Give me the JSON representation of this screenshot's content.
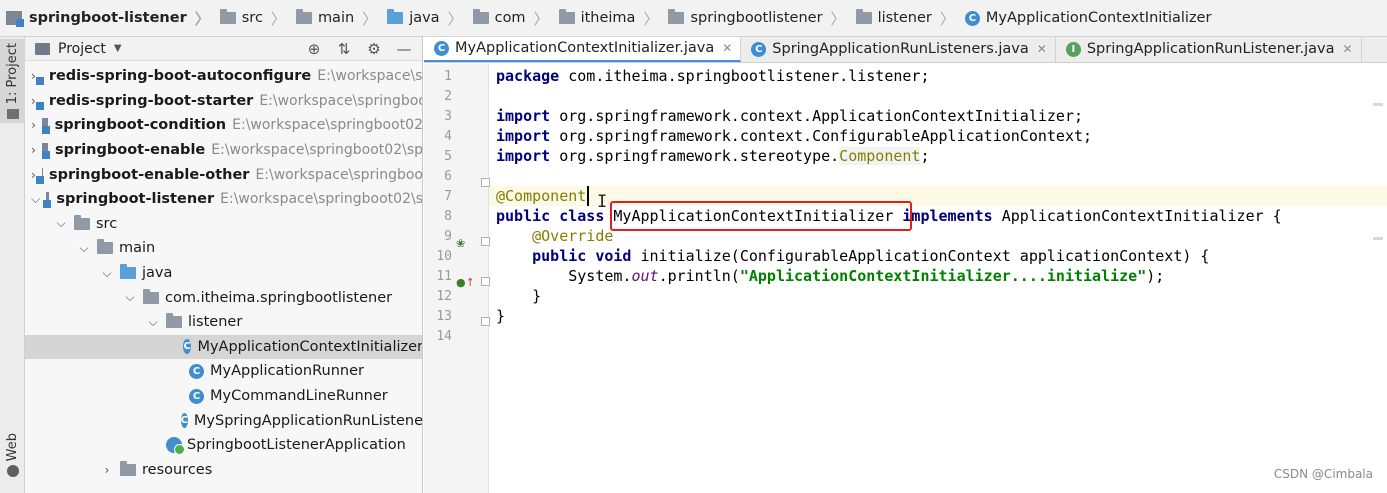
{
  "breadcrumb": [
    {
      "label": "springboot-listener",
      "icon": "module-icon"
    },
    {
      "label": "src",
      "icon": "folder-icon"
    },
    {
      "label": "main",
      "icon": "folder-icon"
    },
    {
      "label": "java",
      "icon": "source-folder-icon"
    },
    {
      "label": "com",
      "icon": "folder-icon"
    },
    {
      "label": "itheima",
      "icon": "folder-icon"
    },
    {
      "label": "springbootlistener",
      "icon": "folder-icon"
    },
    {
      "label": "listener",
      "icon": "folder-icon"
    },
    {
      "label": "MyApplicationContextInitializer",
      "icon": "class-icon"
    }
  ],
  "tool_strip": {
    "project_tab": "1: Project",
    "web_tab": "Web"
  },
  "panel": {
    "title": "Project",
    "tree": [
      {
        "label": "redis-spring-boot-autoconfigure",
        "path": "E:\\workspace\\sp",
        "bold": true,
        "arrow": "›",
        "icon": "module-icon",
        "indent": 0
      },
      {
        "label": "redis-spring-boot-starter",
        "path": "E:\\workspace\\springboo",
        "bold": true,
        "arrow": "›",
        "icon": "module-icon",
        "indent": 0
      },
      {
        "label": "springboot-condition",
        "path": "E:\\workspace\\springboot02",
        "bold": true,
        "arrow": "›",
        "icon": "module-icon",
        "indent": 0
      },
      {
        "label": "springboot-enable",
        "path": "E:\\workspace\\springboot02\\sp",
        "bold": true,
        "arrow": "›",
        "icon": "module-icon",
        "indent": 0
      },
      {
        "label": "springboot-enable-other",
        "path": "E:\\workspace\\springboo",
        "bold": true,
        "arrow": "›",
        "icon": "module-icon",
        "indent": 0
      },
      {
        "label": "springboot-listener",
        "path": "E:\\workspace\\springboot02\\s",
        "bold": true,
        "arrow": "⌄",
        "icon": "module-icon",
        "indent": 0
      },
      {
        "label": "src",
        "path": "",
        "bold": false,
        "arrow": "⌄",
        "icon": "folder-icon",
        "indent": 1
      },
      {
        "label": "main",
        "path": "",
        "bold": false,
        "arrow": "⌄",
        "icon": "folder-icon",
        "indent": 2
      },
      {
        "label": "java",
        "path": "",
        "bold": false,
        "arrow": "⌄",
        "icon": "source-folder-icon",
        "indent": 3
      },
      {
        "label": "com.itheima.springbootlistener",
        "path": "",
        "bold": false,
        "arrow": "⌄",
        "icon": "package-icon",
        "indent": 4
      },
      {
        "label": "listener",
        "path": "",
        "bold": false,
        "arrow": "⌄",
        "icon": "package-icon",
        "indent": 5
      },
      {
        "label": "MyApplicationContextInitializer",
        "path": "",
        "bold": false,
        "arrow": "",
        "icon": "class-icon",
        "indent": 6,
        "selected": true
      },
      {
        "label": "MyApplicationRunner",
        "path": "",
        "bold": false,
        "arrow": "",
        "icon": "class-icon",
        "indent": 6
      },
      {
        "label": "MyCommandLineRunner",
        "path": "",
        "bold": false,
        "arrow": "",
        "icon": "class-icon",
        "indent": 6
      },
      {
        "label": "MySpringApplicationRunListene",
        "path": "",
        "bold": false,
        "arrow": "",
        "icon": "class-icon",
        "indent": 6
      },
      {
        "label": "SpringbootListenerApplication",
        "path": "",
        "bold": false,
        "arrow": "",
        "icon": "spring-app-icon",
        "indent": 5
      },
      {
        "label": "resources",
        "path": "",
        "bold": false,
        "arrow": "›",
        "icon": "resources-folder-icon",
        "indent": 3
      }
    ]
  },
  "tabs": [
    {
      "label": "MyApplicationContextInitializer.java",
      "icon": "class-icon",
      "active": true
    },
    {
      "label": "SpringApplicationRunListeners.java",
      "icon": "class-icon",
      "active": false
    },
    {
      "label": "SpringApplicationRunListener.java",
      "icon": "interface-icon",
      "active": false
    }
  ],
  "editor": {
    "line_numbers": [
      "1",
      "2",
      "3",
      "4",
      "5",
      "6",
      "7",
      "8",
      "9",
      "10",
      "11",
      "12",
      "13",
      "14"
    ],
    "code": {
      "l1_kw": "package",
      "l1_rest": " com.itheima.springbootlistener.listener;",
      "l3_kw": "import",
      "l3_rest": " org.springframework.context.ApplicationContextInitializer;",
      "l4_kw": "import",
      "l4_rest": " org.springframework.context.ConfigurableApplicationContext;",
      "l5_kw": "import",
      "l5_rest": " org.springframework.stereotype.",
      "l5_unused": "Component",
      "l5_end": ";",
      "l7_ann": "@Component",
      "l8_kw1": "public class",
      "l8_name": " MyApplicationContextInitializer ",
      "l8_kw2": "implements",
      "l8_rest": " ApplicationContextInitializer {",
      "l9_ann": "    @Override",
      "l10_kw": "    public void",
      "l10_rest": " initialize(ConfigurableApplicationContext applicationContext) {",
      "l11_pre": "        System.",
      "l11_out": "out",
      "l11_mid": ".println(",
      "l11_str": "\"ApplicationContextInitializer....initialize\"",
      "l11_end": ");",
      "l12": "    }",
      "l13": "}"
    }
  },
  "watermark": "CSDN @Cimbala",
  "colors": {
    "keyword": "#00007f",
    "annotation": "#808000",
    "string": "#008000",
    "highlight_box": "#e02020",
    "current_line": "#fcfae6"
  }
}
